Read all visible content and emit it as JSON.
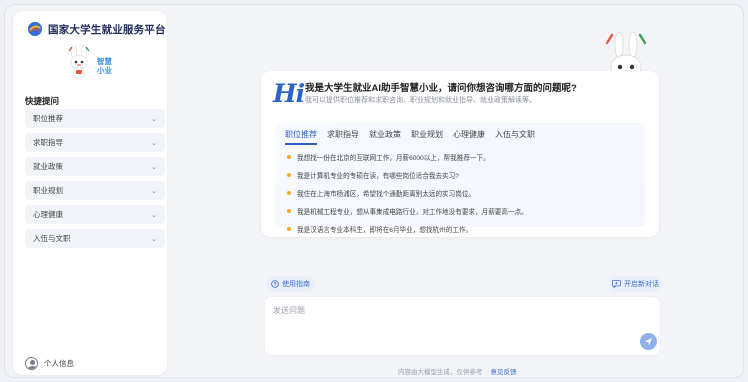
{
  "app": {
    "title": "国家大学生就业服务平台",
    "mascot_label_line1": "智慧",
    "mascot_label_line2": "小业"
  },
  "sidebar": {
    "quick_title": "快捷提问",
    "items": [
      {
        "label": "职位推荐"
      },
      {
        "label": "求职指导"
      },
      {
        "label": "就业政策"
      },
      {
        "label": "职业规划"
      },
      {
        "label": "心理健康"
      },
      {
        "label": "入伍与文职"
      }
    ],
    "user_label": "个人信息"
  },
  "welcome": {
    "hi": "Hi",
    "greeting": "我是大学生就业AI助手智慧小业，请问你想咨询哪方面的问题呢?",
    "subtitle": "我可以提供职位推荐和求职咨询、职业规划和就业指导、就业政策解读等。",
    "tabs": [
      {
        "label": "职位推荐",
        "active": true
      },
      {
        "label": "求职指导",
        "active": false
      },
      {
        "label": "就业政策",
        "active": false
      },
      {
        "label": "职业规划",
        "active": false
      },
      {
        "label": "心理健康",
        "active": false
      },
      {
        "label": "入伍与文职",
        "active": false
      }
    ],
    "questions": [
      "我想找一份在北京的互联网工作，月薪6000以上，帮我推荐一下。",
      "我是计算机专业的专硕在读，有哪些岗位适合我去实习?",
      "我住在上海市杨浦区，希望找个通勤距离别太远的实习岗位。",
      "我是机械工程专业，想从事集成电路行业，对工作地没有要求，月薪要高一点。",
      "我是汉语言专业本科生，即将在6月毕业，想找杭州的工作。"
    ]
  },
  "actions": {
    "guide_label": "使用指南",
    "new_chat_label": "开启新对话"
  },
  "input": {
    "placeholder": "发送问题"
  },
  "footer": {
    "disclaimer": "内容由大模型生成，仅供参考",
    "feedback": "意见反馈"
  },
  "colors": {
    "accent": "#2c5dc4",
    "dot": "#f0a92b",
    "send": "#8fb0ea"
  }
}
